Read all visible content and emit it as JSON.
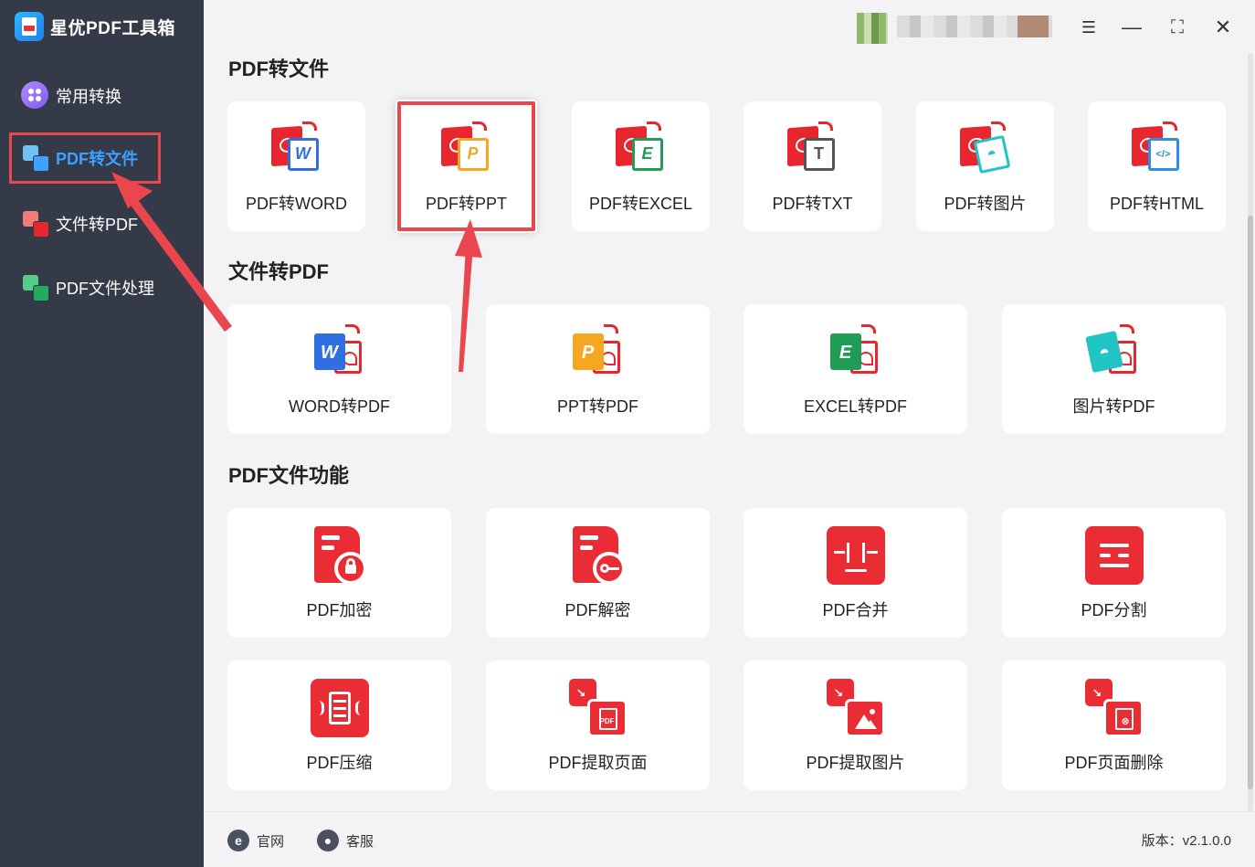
{
  "app": {
    "title": "星优PDF工具箱",
    "version": "版本：v2.1.0.0"
  },
  "sidebar": {
    "items": [
      {
        "label": "常用转换",
        "icon": "grid-icon"
      },
      {
        "label": "PDF转文件",
        "icon": "pdf-convert-icon",
        "active": true
      },
      {
        "label": "文件转PDF",
        "icon": "file-to-pdf-icon"
      },
      {
        "label": "PDF文件处理",
        "icon": "pdf-process-icon"
      }
    ]
  },
  "sections": {
    "pdf_to_file": {
      "title": "PDF转文件",
      "cards": [
        {
          "label": "PDF转WORD",
          "letter": "W",
          "color": "#2f6fe0"
        },
        {
          "label": "PDF转PPT",
          "letter": "P",
          "color": "#f5a623",
          "highlighted": true
        },
        {
          "label": "PDF转EXCEL",
          "letter": "E",
          "color": "#1f9d55"
        },
        {
          "label": "PDF转TXT",
          "letter": "T",
          "color": "#555555"
        },
        {
          "label": "PDF转图片",
          "letter": "",
          "color": "#20c4c4"
        },
        {
          "label": "PDF转HTML",
          "letter": "</>",
          "color": "#2c8fe6"
        }
      ]
    },
    "file_to_pdf": {
      "title": "文件转PDF",
      "cards": [
        {
          "label": "WORD转PDF",
          "letter": "W",
          "color": "#2f6fe0"
        },
        {
          "label": "PPT转PDF",
          "letter": "P",
          "color": "#f5a623"
        },
        {
          "label": "EXCEL转PDF",
          "letter": "E",
          "color": "#1f9d55"
        },
        {
          "label": "图片转PDF",
          "letter": "",
          "color": "#20c4c4"
        }
      ]
    },
    "pdf_functions": {
      "title": "PDF文件功能",
      "cards": [
        {
          "label": "PDF加密",
          "icon": "lock-icon"
        },
        {
          "label": "PDF解密",
          "icon": "key-icon"
        },
        {
          "label": "PDF合并",
          "icon": "merge-icon"
        },
        {
          "label": "PDF分割",
          "icon": "split-icon"
        },
        {
          "label": "PDF压缩",
          "icon": "compress-icon"
        },
        {
          "label": "PDF提取页面",
          "icon": "extract-page-icon",
          "badge": "PDF"
        },
        {
          "label": "PDF提取图片",
          "icon": "extract-image-icon"
        },
        {
          "label": "PDF页面删除",
          "icon": "delete-page-icon"
        }
      ]
    }
  },
  "footer": {
    "website": "官网",
    "service": "客服"
  },
  "colors": {
    "sidebar_bg": "#343a48",
    "accent_blue": "#3ea0ff",
    "annotation_red": "#e9464d",
    "pdf_red": "#ea2d35"
  }
}
